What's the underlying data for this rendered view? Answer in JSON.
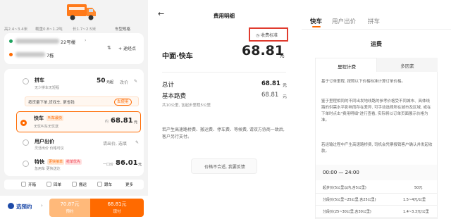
{
  "panel1": {
    "size_row": {
      "item1": "高2.4~3.4米",
      "item2": "载重0.8~1.2吨",
      "item3": "长1.7~2.5米",
      "spec_link": "车型规格"
    },
    "address": {
      "from_suffix": "22号楼",
      "to_suffix": "7栋",
      "add_stop": "途经点"
    },
    "options": [
      {
        "title": "拼车",
        "subtitle": "无少拼车无短程",
        "price": "50",
        "price_unit": "元起",
        "action": "改价"
      },
      {
        "title": "快车",
        "badge1": "叫车最快",
        "subtitle": "无忧叫车无忧送",
        "price": "68.81",
        "price_unit": "元",
        "prefix": "约"
      },
      {
        "title": "用户出价",
        "subtitle": "灵活出价 价格可议",
        "action": "请出价, 选填"
      },
      {
        "title": "特快",
        "badge1": "更快接单",
        "badge2": "抢单优先",
        "subtitle": "急用车 更快送达",
        "price": "86.01",
        "price_unit": "元",
        "prefix": "一口价"
      }
    ],
    "hint": {
      "text": "按货量下单,货找车, 更省钱",
      "btn": "去使用"
    },
    "services": [
      "开箱",
      "回单",
      "搬运",
      "跟车",
      "更多"
    ],
    "bottom": {
      "book_label": "选预约",
      "btn1_price": "70.87元",
      "btn1_sub": "预约",
      "btn2_price": "68.81元",
      "btn2_sub": "现付"
    }
  },
  "panel2": {
    "title": "费用明细",
    "fee_standard": "收费标准",
    "vehicle": "中面·快车",
    "total_price": "68.81",
    "unit": "元",
    "total_label": "总计",
    "total_value": "68.81",
    "base_label": "基本路费",
    "base_value": "68.81",
    "base_note": "共10公里, 含起步里程5公里",
    "notice": "若产生高速路桥费、搬运费、停车费、等候费, 请双方协商一致后, 客户另行支付。",
    "feedback": "价格不合适, 我要反馈"
  },
  "panel3": {
    "tabs": [
      "快车",
      "用户出价",
      "拼车"
    ],
    "section_title": "运费",
    "subtabs": [
      "里程计费",
      "多因素"
    ],
    "para1": "基于订单里程, 按照以下价格标准计算订单价格。",
    "para2": "鉴于里程相同的不同出发地线路的参考价格受不同城市、具体线路的供需水平影响而存在差异, 可手动选择所在城市及区域, 或在下单时点击\"费用明细\"进行查看, 实际将以订单页面展示价格为准。",
    "para3": "若运输过程中产生高速路桥费, 司机会凭票报销客户确认并发起收款。",
    "time_range": "00:00 — 24:00",
    "table": [
      {
        "label": "起步价(5公里以内,含5公里)",
        "value": "50元"
      },
      {
        "label": "分段价(5公里~25公里,含25公里)",
        "value": "1.5~4元/公里"
      },
      {
        "label": "分段价(25~30公里,含30公里)",
        "value": "1.4~3.3元/公里"
      }
    ]
  },
  "colors": {
    "accent": "#ff6a00",
    "red_box": "#e03b2e"
  }
}
